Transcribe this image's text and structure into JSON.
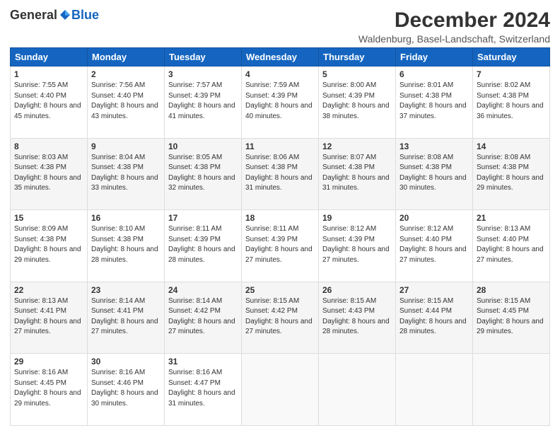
{
  "header": {
    "logo_general": "General",
    "logo_blue": "Blue",
    "month_title": "December 2024",
    "location": "Waldenburg, Basel-Landschaft, Switzerland"
  },
  "weekdays": [
    "Sunday",
    "Monday",
    "Tuesday",
    "Wednesday",
    "Thursday",
    "Friday",
    "Saturday"
  ],
  "weeks": [
    [
      {
        "day": 1,
        "rise": "7:55 AM",
        "set": "4:40 PM",
        "daylight": "8 hours and 45 minutes."
      },
      {
        "day": 2,
        "rise": "7:56 AM",
        "set": "4:40 PM",
        "daylight": "8 hours and 43 minutes."
      },
      {
        "day": 3,
        "rise": "7:57 AM",
        "set": "4:39 PM",
        "daylight": "8 hours and 41 minutes."
      },
      {
        "day": 4,
        "rise": "7:59 AM",
        "set": "4:39 PM",
        "daylight": "8 hours and 40 minutes."
      },
      {
        "day": 5,
        "rise": "8:00 AM",
        "set": "4:39 PM",
        "daylight": "8 hours and 38 minutes."
      },
      {
        "day": 6,
        "rise": "8:01 AM",
        "set": "4:38 PM",
        "daylight": "8 hours and 37 minutes."
      },
      {
        "day": 7,
        "rise": "8:02 AM",
        "set": "4:38 PM",
        "daylight": "8 hours and 36 minutes."
      }
    ],
    [
      {
        "day": 8,
        "rise": "8:03 AM",
        "set": "4:38 PM",
        "daylight": "8 hours and 35 minutes."
      },
      {
        "day": 9,
        "rise": "8:04 AM",
        "set": "4:38 PM",
        "daylight": "8 hours and 33 minutes."
      },
      {
        "day": 10,
        "rise": "8:05 AM",
        "set": "4:38 PM",
        "daylight": "8 hours and 32 minutes."
      },
      {
        "day": 11,
        "rise": "8:06 AM",
        "set": "4:38 PM",
        "daylight": "8 hours and 31 minutes."
      },
      {
        "day": 12,
        "rise": "8:07 AM",
        "set": "4:38 PM",
        "daylight": "8 hours and 31 minutes."
      },
      {
        "day": 13,
        "rise": "8:08 AM",
        "set": "4:38 PM",
        "daylight": "8 hours and 30 minutes."
      },
      {
        "day": 14,
        "rise": "8:08 AM",
        "set": "4:38 PM",
        "daylight": "8 hours and 29 minutes."
      }
    ],
    [
      {
        "day": 15,
        "rise": "8:09 AM",
        "set": "4:38 PM",
        "daylight": "8 hours and 29 minutes."
      },
      {
        "day": 16,
        "rise": "8:10 AM",
        "set": "4:38 PM",
        "daylight": "8 hours and 28 minutes."
      },
      {
        "day": 17,
        "rise": "8:11 AM",
        "set": "4:39 PM",
        "daylight": "8 hours and 28 minutes."
      },
      {
        "day": 18,
        "rise": "8:11 AM",
        "set": "4:39 PM",
        "daylight": "8 hours and 27 minutes."
      },
      {
        "day": 19,
        "rise": "8:12 AM",
        "set": "4:39 PM",
        "daylight": "8 hours and 27 minutes."
      },
      {
        "day": 20,
        "rise": "8:12 AM",
        "set": "4:40 PM",
        "daylight": "8 hours and 27 minutes."
      },
      {
        "day": 21,
        "rise": "8:13 AM",
        "set": "4:40 PM",
        "daylight": "8 hours and 27 minutes."
      }
    ],
    [
      {
        "day": 22,
        "rise": "8:13 AM",
        "set": "4:41 PM",
        "daylight": "8 hours and 27 minutes."
      },
      {
        "day": 23,
        "rise": "8:14 AM",
        "set": "4:41 PM",
        "daylight": "8 hours and 27 minutes."
      },
      {
        "day": 24,
        "rise": "8:14 AM",
        "set": "4:42 PM",
        "daylight": "8 hours and 27 minutes."
      },
      {
        "day": 25,
        "rise": "8:15 AM",
        "set": "4:42 PM",
        "daylight": "8 hours and 27 minutes."
      },
      {
        "day": 26,
        "rise": "8:15 AM",
        "set": "4:43 PM",
        "daylight": "8 hours and 28 minutes."
      },
      {
        "day": 27,
        "rise": "8:15 AM",
        "set": "4:44 PM",
        "daylight": "8 hours and 28 minutes."
      },
      {
        "day": 28,
        "rise": "8:15 AM",
        "set": "4:45 PM",
        "daylight": "8 hours and 29 minutes."
      }
    ],
    [
      {
        "day": 29,
        "rise": "8:16 AM",
        "set": "4:45 PM",
        "daylight": "8 hours and 29 minutes."
      },
      {
        "day": 30,
        "rise": "8:16 AM",
        "set": "4:46 PM",
        "daylight": "8 hours and 30 minutes."
      },
      {
        "day": 31,
        "rise": "8:16 AM",
        "set": "4:47 PM",
        "daylight": "8 hours and 31 minutes."
      },
      null,
      null,
      null,
      null
    ]
  ]
}
